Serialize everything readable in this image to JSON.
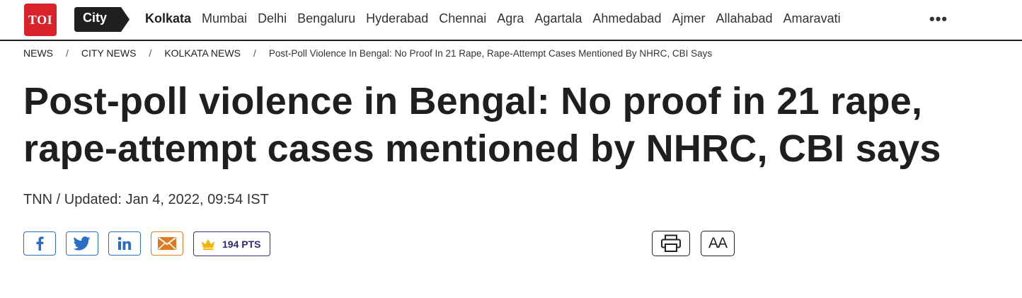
{
  "brand": {
    "logo_text": "TOI",
    "logo_color": "#d9222a",
    "section_tag": "City"
  },
  "nav": {
    "cities": [
      "Kolkata",
      "Mumbai",
      "Delhi",
      "Bengaluru",
      "Hyderabad",
      "Chennai",
      "Agra",
      "Agartala",
      "Ahmedabad",
      "Ajmer",
      "Allahabad",
      "Amaravati"
    ],
    "active_city": "Kolkata",
    "more_icon": "ellipsis-icon",
    "more_text": "•••"
  },
  "breadcrumb": {
    "items": [
      "NEWS",
      "CITY NEWS",
      "KOLKATA NEWS"
    ],
    "separator": "/",
    "current": "Post-Poll Violence In Bengal: No Proof In 21 Rape, Rape-Attempt Cases Mentioned By NHRC, CBI Says"
  },
  "article": {
    "headline_line1": "Post-poll violence in Bengal: No proof in 21 rape,",
    "headline_line2": "rape-attempt cases mentioned by NHRC, CBI says",
    "byline": "TNN / Updated: Jan 4, 2022, 09:54 IST"
  },
  "share": {
    "facebook_icon": "facebook-icon",
    "twitter_icon": "twitter-icon",
    "linkedin_icon": "linkedin-icon",
    "mail_icon": "mail-icon",
    "points_icon": "crown-icon",
    "points_label": "194 PTS",
    "share_color": "#2b6dc6",
    "mail_color": "#e07a1f",
    "points_color": "#2c2a7a"
  },
  "tools": {
    "print_icon": "print-icon",
    "font_size_label": "AA"
  }
}
